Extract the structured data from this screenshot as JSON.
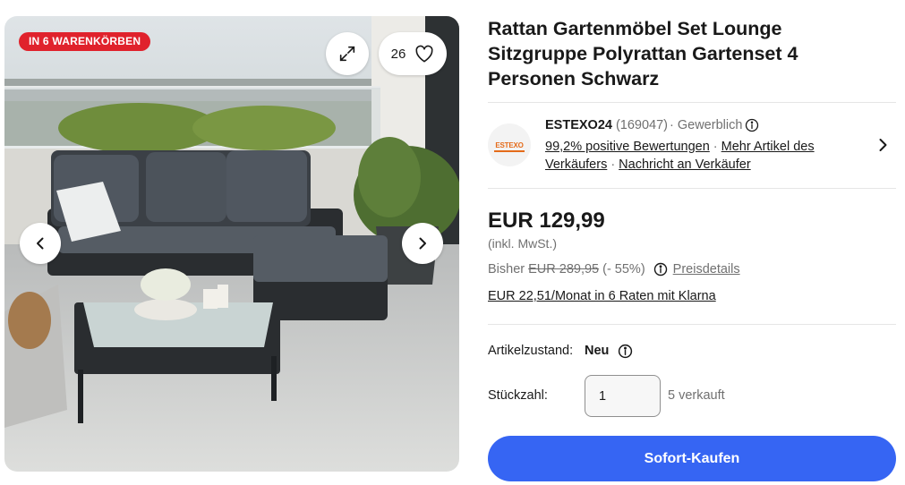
{
  "gallery": {
    "badge": "IN 6 WARENKÖRBEN",
    "watch_count": "26",
    "icons": {
      "expand": "expand-icon",
      "heart": "heart-icon",
      "prev": "chevron-left-icon",
      "next": "chevron-right-icon"
    }
  },
  "product": {
    "title": "Rattan Gartenmöbel Set Lounge Sitzgruppe Polyrattan Gartenset 4 Personen Schwarz"
  },
  "seller": {
    "logo_text": "ESTEXO",
    "name": "ESTEXO24",
    "feedback_count": "(169047)",
    "type": "· Gewerblich",
    "positive": "99,2% positive Bewertungen",
    "more_items": "Mehr Artikel des Verkäufers",
    "contact": "Nachricht an Verkäufer",
    "separator": "·"
  },
  "pricing": {
    "price": "EUR 129,99",
    "tax_note": "(inkl. MwSt.)",
    "was_label": "Bisher",
    "was_price": "EUR 289,95",
    "discount": "(- 55%)",
    "details_link": "Preisdetails",
    "installments": "EUR 22,51/Monat in 6 Raten mit Klarna"
  },
  "condition": {
    "label": "Artikelzustand:",
    "value": "Neu"
  },
  "quantity": {
    "label": "Stückzahl:",
    "value": "1",
    "sold": "5 verkauft"
  },
  "actions": {
    "buy_now": "Sofort-Kaufen"
  },
  "colors": {
    "badge": "#e0222c",
    "primary_button": "#3665f3",
    "text": "#191919",
    "secondary_text": "#707070"
  }
}
